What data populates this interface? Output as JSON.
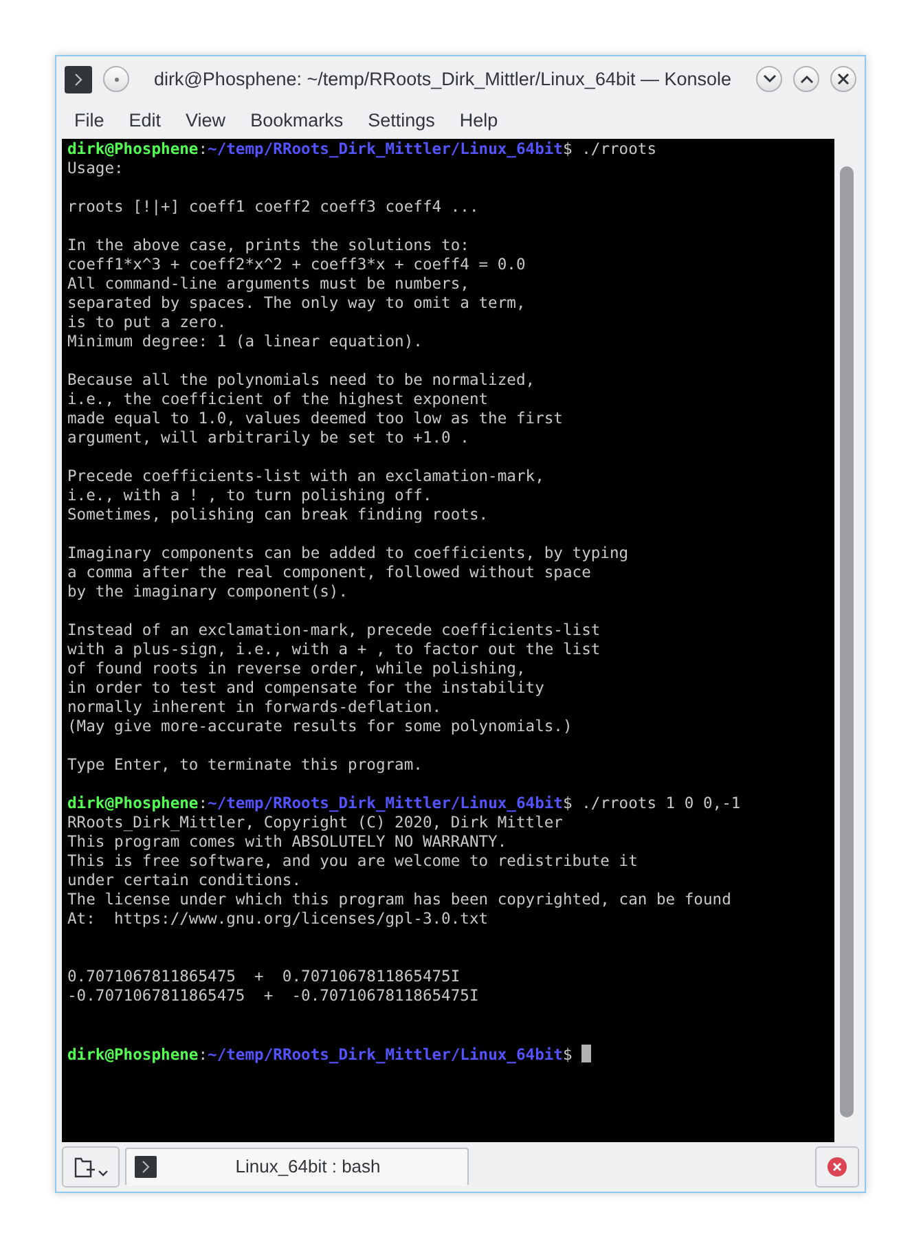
{
  "window": {
    "title": "dirk@Phosphene: ~/temp/RRoots_Dirk_Mittler/Linux_64bit — Konsole"
  },
  "menu": [
    "File",
    "Edit",
    "View",
    "Bookmarks",
    "Settings",
    "Help"
  ],
  "terminal": {
    "lines": [
      {
        "kind": "prompt",
        "user_host": "dirk@Phosphene",
        "sep": ":",
        "path": "~/temp/RRoots_Dirk_Mittler/Linux_64bit",
        "command": "$ ./rroots",
        "cursor": false
      },
      {
        "kind": "text",
        "text": "Usage:"
      },
      {
        "kind": "blank"
      },
      {
        "kind": "text",
        "text": "rroots [!|+] coeff1 coeff2 coeff3 coeff4 ..."
      },
      {
        "kind": "blank"
      },
      {
        "kind": "text",
        "text": "In the above case, prints the solutions to:"
      },
      {
        "kind": "text",
        "text": "coeff1*x^3 + coeff2*x^2 + coeff3*x + coeff4 = 0.0"
      },
      {
        "kind": "text",
        "text": "All command-line arguments must be numbers,"
      },
      {
        "kind": "text",
        "text": "separated by spaces. The only way to omit a term,"
      },
      {
        "kind": "text",
        "text": "is to put a zero."
      },
      {
        "kind": "text",
        "text": "Minimum degree: 1 (a linear equation)."
      },
      {
        "kind": "blank"
      },
      {
        "kind": "text",
        "text": "Because all the polynomials need to be normalized,"
      },
      {
        "kind": "text",
        "text": "i.e., the coefficient of the highest exponent"
      },
      {
        "kind": "text",
        "text": "made equal to 1.0, values deemed too low as the first"
      },
      {
        "kind": "text",
        "text": "argument, will arbitrarily be set to +1.0 ."
      },
      {
        "kind": "blank"
      },
      {
        "kind": "text",
        "text": "Precede coefficients-list with an exclamation-mark,"
      },
      {
        "kind": "text",
        "text": "i.e., with a ! , to turn polishing off."
      },
      {
        "kind": "text",
        "text": "Sometimes, polishing can break finding roots."
      },
      {
        "kind": "blank"
      },
      {
        "kind": "text",
        "text": "Imaginary components can be added to coefficients, by typing"
      },
      {
        "kind": "text",
        "text": "a comma after the real component, followed without space"
      },
      {
        "kind": "text",
        "text": "by the imaginary component(s)."
      },
      {
        "kind": "blank"
      },
      {
        "kind": "text",
        "text": "Instead of an exclamation-mark, precede coefficients-list"
      },
      {
        "kind": "text",
        "text": "with a plus-sign, i.e., with a + , to factor out the list"
      },
      {
        "kind": "text",
        "text": "of found roots in reverse order, while polishing,"
      },
      {
        "kind": "text",
        "text": "in order to test and compensate for the instability"
      },
      {
        "kind": "text",
        "text": "normally inherent in forwards-deflation."
      },
      {
        "kind": "text",
        "text": "(May give more-accurate results for some polynomials.)"
      },
      {
        "kind": "blank"
      },
      {
        "kind": "text",
        "text": "Type Enter, to terminate this program."
      },
      {
        "kind": "blank"
      },
      {
        "kind": "prompt",
        "user_host": "dirk@Phosphene",
        "sep": ":",
        "path": "~/temp/RRoots_Dirk_Mittler/Linux_64bit",
        "command": "$ ./rroots 1 0 0,-1",
        "cursor": false
      },
      {
        "kind": "text",
        "text": "RRoots_Dirk_Mittler, Copyright (C) 2020, Dirk Mittler"
      },
      {
        "kind": "text",
        "text": "This program comes with ABSOLUTELY NO WARRANTY."
      },
      {
        "kind": "text",
        "text": "This is free software, and you are welcome to redistribute it"
      },
      {
        "kind": "text",
        "text": "under certain conditions."
      },
      {
        "kind": "text",
        "text": "The license under which this program has been copyrighted, can be found"
      },
      {
        "kind": "text",
        "text": "At:  https://www.gnu.org/licenses/gpl-3.0.txt"
      },
      {
        "kind": "blank"
      },
      {
        "kind": "blank"
      },
      {
        "kind": "text",
        "text": "0.7071067811865475  +  0.7071067811865475I"
      },
      {
        "kind": "text",
        "text": "-0.7071067811865475  +  -0.7071067811865475I"
      },
      {
        "kind": "blank"
      },
      {
        "kind": "blank"
      },
      {
        "kind": "prompt",
        "user_host": "dirk@Phosphene",
        "sep": ":",
        "path": "~/temp/RRoots_Dirk_Mittler/Linux_64bit",
        "command": "$ ",
        "cursor": true
      }
    ]
  },
  "tabs": [
    {
      "label": "Linux_64bit : bash",
      "selected": true
    }
  ]
}
